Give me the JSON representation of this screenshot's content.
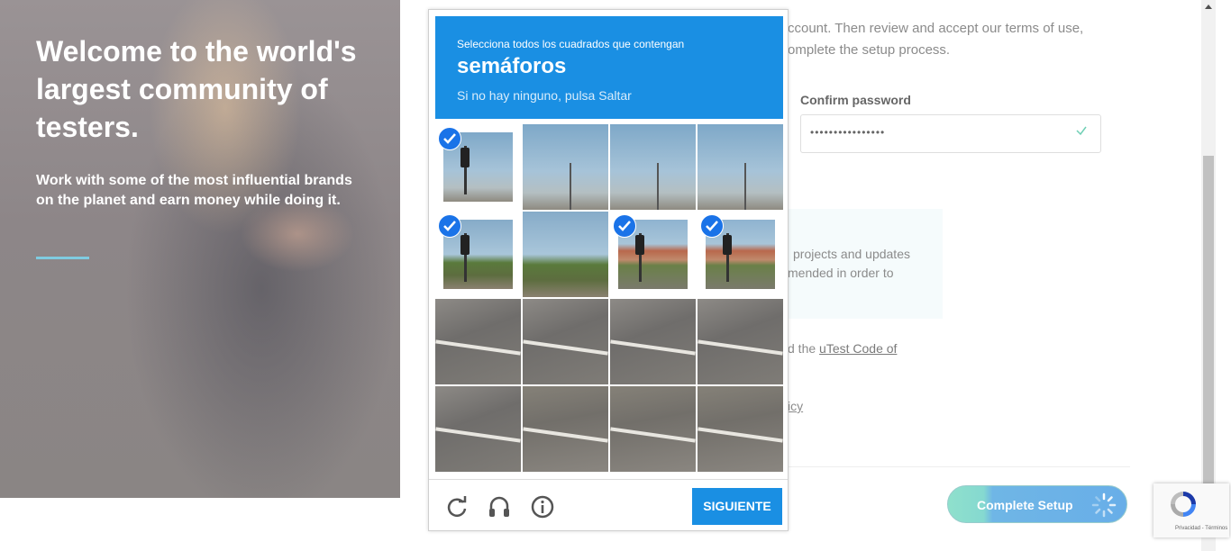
{
  "hero": {
    "title": "Welcome to the world's largest community of testers.",
    "subtitle": "Work with some of the most influential brands on the planet and earn money while doing it.",
    "accent_color": "#7fcbe0"
  },
  "form": {
    "intro_line1": "ccount. Then review and accept our terms of use,",
    "intro_line2": "omplete the setup process.",
    "confirm_password": {
      "label": "Confirm password",
      "value": "••••••••••••••••"
    },
    "info_line1": "projects and updates",
    "info_line2": "mended in order to",
    "code_prefix": "d the",
    "code_link": "uTest Code of",
    "policy_fragment": "icy",
    "complete_button": "Complete Setup"
  },
  "captcha": {
    "instruction": "Selecciona todos los cuadrados que contengan",
    "target": "semáforos",
    "hint": "Si no hay ninguno, pulsa Saltar",
    "next_button": "SIGUIENTE",
    "header_color": "#1a8fe3",
    "tiles": [
      {
        "scene": "sky-traffic-light",
        "selected": true
      },
      {
        "scene": "sky-streetlight",
        "selected": false
      },
      {
        "scene": "sky-streetlight",
        "selected": false
      },
      {
        "scene": "sky-streetlight",
        "selected": false
      },
      {
        "scene": "sky-traffic-light-trees",
        "selected": true
      },
      {
        "scene": "trees-intersection",
        "selected": false
      },
      {
        "scene": "building-traffic-light",
        "selected": true
      },
      {
        "scene": "building-traffic-light",
        "selected": true
      },
      {
        "scene": "road-cars",
        "selected": false
      },
      {
        "scene": "road-cars",
        "selected": false
      },
      {
        "scene": "road",
        "selected": false
      },
      {
        "scene": "road",
        "selected": false
      },
      {
        "scene": "road-curb",
        "selected": false
      },
      {
        "scene": "road-lines",
        "selected": false
      },
      {
        "scene": "road-lines",
        "selected": false
      },
      {
        "scene": "road-lines",
        "selected": false
      }
    ],
    "icons": [
      "reload-icon",
      "audio-icon",
      "info-icon"
    ]
  },
  "recaptcha_badge": {
    "text": "Privacidad - Términos"
  }
}
